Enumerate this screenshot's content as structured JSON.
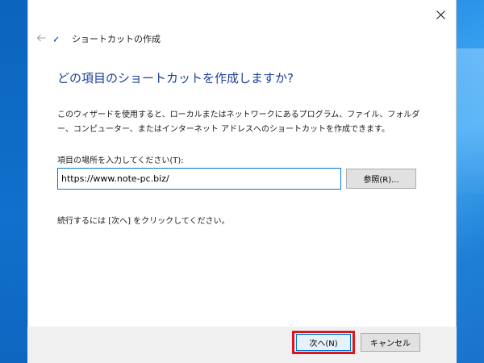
{
  "window": {
    "title": "ショートカットの作成",
    "close_icon": "close-icon",
    "back_icon": "back-arrow-icon"
  },
  "wizard": {
    "heading": "どの項目のショートカットを作成しますか?",
    "description": "このウィザードを使用すると、ローカルまたはネットワークにあるプログラム、ファイル、フォルダー、コンピューター、またはインターネット アドレスへのショートカットを作成できます。",
    "location_label": "項目の場所を入力してください(T):",
    "location_value": "https://www.note-pc.biz/",
    "browse_label": "参照(R)...",
    "hint": "続行するには [次へ] をクリックしてください。"
  },
  "footer": {
    "next_label": "次へ(N)",
    "cancel_label": "キャンセル"
  },
  "colors": {
    "heading": "#1f3f99",
    "accent": "#0078d7",
    "highlight": "#e0141c"
  }
}
